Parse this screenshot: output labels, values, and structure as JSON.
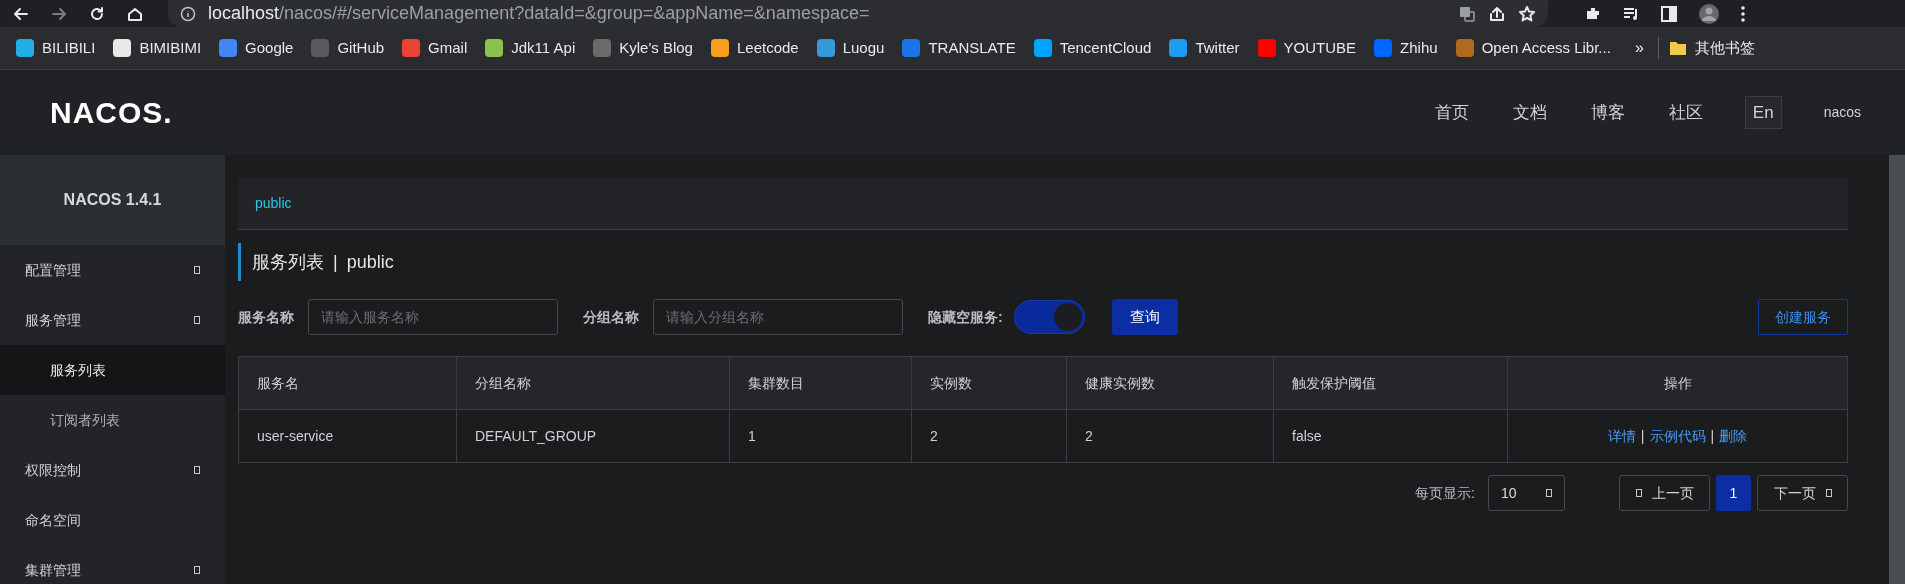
{
  "browser": {
    "url_host": "localhost",
    "url_path": "/nacos/#/serviceManagement?dataId=&group=&appName=&namespace=",
    "bookmarks": [
      {
        "label": "BILIBILI",
        "color": "#23ade5"
      },
      {
        "label": "BIMIBIMI",
        "color": "#e8e8e8"
      },
      {
        "label": "Google",
        "color": "#4285f4"
      },
      {
        "label": "GitHub",
        "color": "#5a5a5a"
      },
      {
        "label": "Gmail",
        "color": "#ea4335"
      },
      {
        "label": "Jdk11 Api",
        "color": "#8bc34a"
      },
      {
        "label": "Kyle's Blog",
        "color": "#6a6a6a"
      },
      {
        "label": "Leetcode",
        "color": "#f89f1b"
      },
      {
        "label": "Luogu",
        "color": "#3498db"
      },
      {
        "label": "TRANSLATE",
        "color": "#1a73e8"
      },
      {
        "label": "TencentCloud",
        "color": "#00a3ff"
      },
      {
        "label": "Twitter",
        "color": "#1d9bf0"
      },
      {
        "label": "YOUTUBE",
        "color": "#ff0000"
      },
      {
        "label": "Zhihu",
        "color": "#0066ff"
      },
      {
        "label": "Open Access Libr...",
        "color": "#b06a1c"
      }
    ],
    "more": "»",
    "other_bookmarks": "其他书签"
  },
  "header": {
    "logo": "NACOS.",
    "nav": [
      {
        "label": "首页",
        "kind": "link"
      },
      {
        "label": "文档",
        "kind": "link"
      },
      {
        "label": "博客",
        "kind": "link"
      },
      {
        "label": "社区",
        "kind": "link"
      },
      {
        "label": "En",
        "kind": "boxed"
      },
      {
        "label": "nacos",
        "kind": "user"
      }
    ]
  },
  "sidebar": {
    "title": "NACOS 1.4.1",
    "items": [
      {
        "label": "配置管理",
        "kind": "menu"
      },
      {
        "label": "服务管理",
        "kind": "menu",
        "children": [
          {
            "label": "服务列表",
            "selected": true
          },
          {
            "label": "订阅者列表",
            "selected": false
          }
        ]
      },
      {
        "label": "权限控制",
        "kind": "menu"
      },
      {
        "label": "命名空间",
        "kind": "link"
      },
      {
        "label": "集群管理",
        "kind": "menu"
      }
    ]
  },
  "breadcrumb": "public",
  "title": {
    "text": "服务列表",
    "separator": "|",
    "namespace": "public"
  },
  "filters": [
    {
      "label": "服务名称",
      "placeholder": "请输入服务名称"
    },
    {
      "label": "分组名称",
      "placeholder": "请输入分组名称"
    }
  ],
  "hide_empty": {
    "label": "隐藏空服务:",
    "on": true
  },
  "query_button": "查询",
  "create_button": "创建服务",
  "table": {
    "columns": [
      "服务名",
      "分组名称",
      "集群数目",
      "实例数",
      "健康实例数",
      "触发保护阈值",
      "操作"
    ],
    "rows": [
      {
        "cells": [
          "user-service",
          "DEFAULT_GROUP",
          "1",
          "2",
          "2",
          "false"
        ],
        "actions": [
          {
            "kind": "link",
            "label": "详情"
          },
          {
            "kind": "separator",
            "label": "|"
          },
          {
            "kind": "link",
            "label": "示例代码"
          },
          {
            "kind": "separator",
            "label": "|"
          },
          {
            "kind": "link",
            "label": "删除"
          }
        ]
      }
    ]
  },
  "pagination": {
    "page_size_label": "每页显示:",
    "page_size": "10",
    "prev": "上一页",
    "pages": [
      {
        "label": "1",
        "selected": true
      }
    ],
    "next": "下一页"
  }
}
